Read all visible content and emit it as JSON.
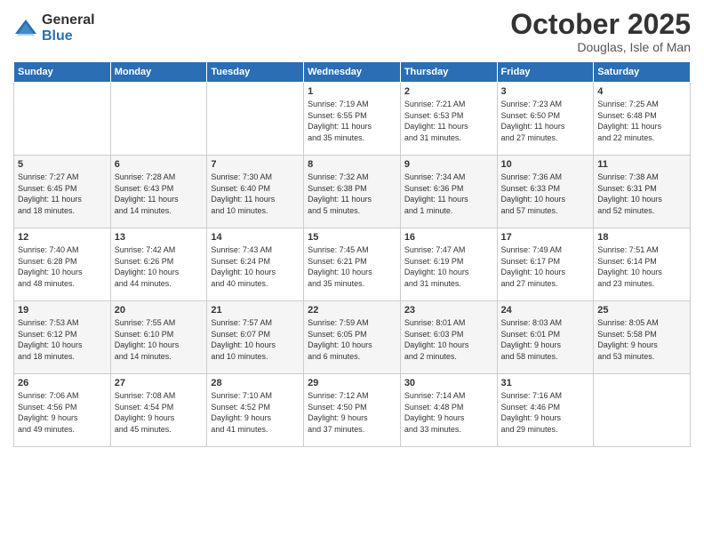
{
  "logo": {
    "general": "General",
    "blue": "Blue"
  },
  "header": {
    "month": "October 2025",
    "location": "Douglas, Isle of Man"
  },
  "days_of_week": [
    "Sunday",
    "Monday",
    "Tuesday",
    "Wednesday",
    "Thursday",
    "Friday",
    "Saturday"
  ],
  "weeks": [
    [
      {
        "day": "",
        "info": ""
      },
      {
        "day": "",
        "info": ""
      },
      {
        "day": "",
        "info": ""
      },
      {
        "day": "1",
        "info": "Sunrise: 7:19 AM\nSunset: 6:55 PM\nDaylight: 11 hours\nand 35 minutes."
      },
      {
        "day": "2",
        "info": "Sunrise: 7:21 AM\nSunset: 6:53 PM\nDaylight: 11 hours\nand 31 minutes."
      },
      {
        "day": "3",
        "info": "Sunrise: 7:23 AM\nSunset: 6:50 PM\nDaylight: 11 hours\nand 27 minutes."
      },
      {
        "day": "4",
        "info": "Sunrise: 7:25 AM\nSunset: 6:48 PM\nDaylight: 11 hours\nand 22 minutes."
      }
    ],
    [
      {
        "day": "5",
        "info": "Sunrise: 7:27 AM\nSunset: 6:45 PM\nDaylight: 11 hours\nand 18 minutes."
      },
      {
        "day": "6",
        "info": "Sunrise: 7:28 AM\nSunset: 6:43 PM\nDaylight: 11 hours\nand 14 minutes."
      },
      {
        "day": "7",
        "info": "Sunrise: 7:30 AM\nSunset: 6:40 PM\nDaylight: 11 hours\nand 10 minutes."
      },
      {
        "day": "8",
        "info": "Sunrise: 7:32 AM\nSunset: 6:38 PM\nDaylight: 11 hours\nand 5 minutes."
      },
      {
        "day": "9",
        "info": "Sunrise: 7:34 AM\nSunset: 6:36 PM\nDaylight: 11 hours\nand 1 minute."
      },
      {
        "day": "10",
        "info": "Sunrise: 7:36 AM\nSunset: 6:33 PM\nDaylight: 10 hours\nand 57 minutes."
      },
      {
        "day": "11",
        "info": "Sunrise: 7:38 AM\nSunset: 6:31 PM\nDaylight: 10 hours\nand 52 minutes."
      }
    ],
    [
      {
        "day": "12",
        "info": "Sunrise: 7:40 AM\nSunset: 6:28 PM\nDaylight: 10 hours\nand 48 minutes."
      },
      {
        "day": "13",
        "info": "Sunrise: 7:42 AM\nSunset: 6:26 PM\nDaylight: 10 hours\nand 44 minutes."
      },
      {
        "day": "14",
        "info": "Sunrise: 7:43 AM\nSunset: 6:24 PM\nDaylight: 10 hours\nand 40 minutes."
      },
      {
        "day": "15",
        "info": "Sunrise: 7:45 AM\nSunset: 6:21 PM\nDaylight: 10 hours\nand 35 minutes."
      },
      {
        "day": "16",
        "info": "Sunrise: 7:47 AM\nSunset: 6:19 PM\nDaylight: 10 hours\nand 31 minutes."
      },
      {
        "day": "17",
        "info": "Sunrise: 7:49 AM\nSunset: 6:17 PM\nDaylight: 10 hours\nand 27 minutes."
      },
      {
        "day": "18",
        "info": "Sunrise: 7:51 AM\nSunset: 6:14 PM\nDaylight: 10 hours\nand 23 minutes."
      }
    ],
    [
      {
        "day": "19",
        "info": "Sunrise: 7:53 AM\nSunset: 6:12 PM\nDaylight: 10 hours\nand 18 minutes."
      },
      {
        "day": "20",
        "info": "Sunrise: 7:55 AM\nSunset: 6:10 PM\nDaylight: 10 hours\nand 14 minutes."
      },
      {
        "day": "21",
        "info": "Sunrise: 7:57 AM\nSunset: 6:07 PM\nDaylight: 10 hours\nand 10 minutes."
      },
      {
        "day": "22",
        "info": "Sunrise: 7:59 AM\nSunset: 6:05 PM\nDaylight: 10 hours\nand 6 minutes."
      },
      {
        "day": "23",
        "info": "Sunrise: 8:01 AM\nSunset: 6:03 PM\nDaylight: 10 hours\nand 2 minutes."
      },
      {
        "day": "24",
        "info": "Sunrise: 8:03 AM\nSunset: 6:01 PM\nDaylight: 9 hours\nand 58 minutes."
      },
      {
        "day": "25",
        "info": "Sunrise: 8:05 AM\nSunset: 5:58 PM\nDaylight: 9 hours\nand 53 minutes."
      }
    ],
    [
      {
        "day": "26",
        "info": "Sunrise: 7:06 AM\nSunset: 4:56 PM\nDaylight: 9 hours\nand 49 minutes."
      },
      {
        "day": "27",
        "info": "Sunrise: 7:08 AM\nSunset: 4:54 PM\nDaylight: 9 hours\nand 45 minutes."
      },
      {
        "day": "28",
        "info": "Sunrise: 7:10 AM\nSunset: 4:52 PM\nDaylight: 9 hours\nand 41 minutes."
      },
      {
        "day": "29",
        "info": "Sunrise: 7:12 AM\nSunset: 4:50 PM\nDaylight: 9 hours\nand 37 minutes."
      },
      {
        "day": "30",
        "info": "Sunrise: 7:14 AM\nSunset: 4:48 PM\nDaylight: 9 hours\nand 33 minutes."
      },
      {
        "day": "31",
        "info": "Sunrise: 7:16 AM\nSunset: 4:46 PM\nDaylight: 9 hours\nand 29 minutes."
      },
      {
        "day": "",
        "info": ""
      }
    ]
  ]
}
